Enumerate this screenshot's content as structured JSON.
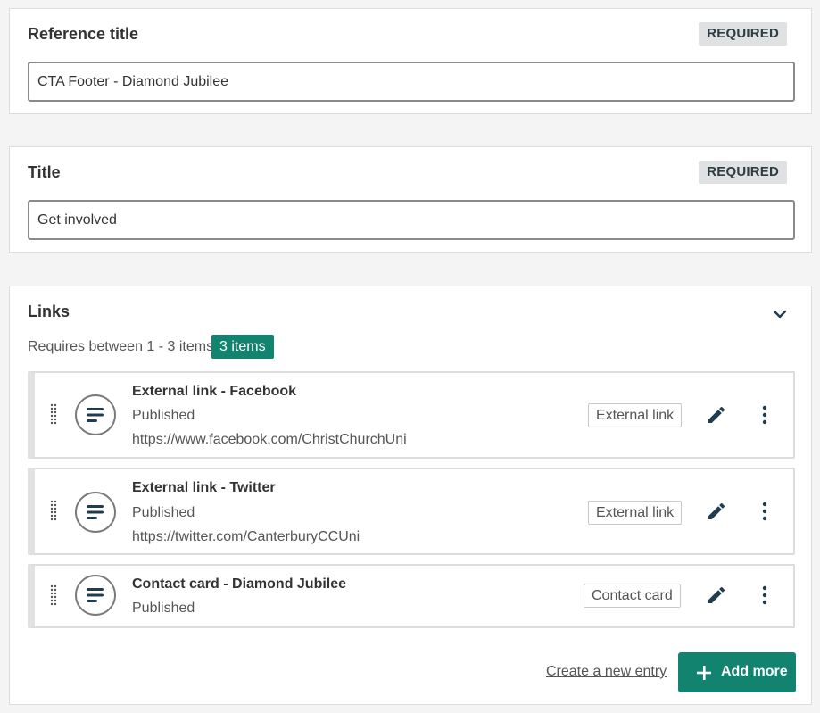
{
  "reference_title": {
    "label": "Reference title",
    "badge": "REQUIRED",
    "value": "CTA Footer - Diamond Jubilee"
  },
  "title": {
    "label": "Title",
    "badge": "REQUIRED",
    "value": "Get involved"
  },
  "links": {
    "label": "Links",
    "requirement": "Requires between 1 - 3 items",
    "count_badge": "3 items",
    "entries": [
      {
        "title": "External link - Facebook",
        "status": "Published",
        "url": "https://www.facebook.com/ChristChurchUni",
        "type": "External link"
      },
      {
        "title": "External link - Twitter",
        "status": "Published",
        "url": "https://twitter.com/CanterburyCCUni",
        "type": "External link"
      },
      {
        "title": "Contact card - Diamond Jubilee",
        "status": "Published",
        "type": "Contact card"
      }
    ],
    "create_link": "Create a new entry",
    "add_more": "Add more"
  },
  "icons": {
    "entry": "entry-icon",
    "drag": "drag-handle-icon",
    "edit": "pencil-icon",
    "more": "more-vertical-icon",
    "collapse": "chevron-down-icon",
    "add": "plus-icon"
  },
  "colors": {
    "accent": "#12836f",
    "badge_bg": "#dfe1e3",
    "badge_text": "#2d3c45",
    "icon_dark": "#1f3d4f"
  }
}
